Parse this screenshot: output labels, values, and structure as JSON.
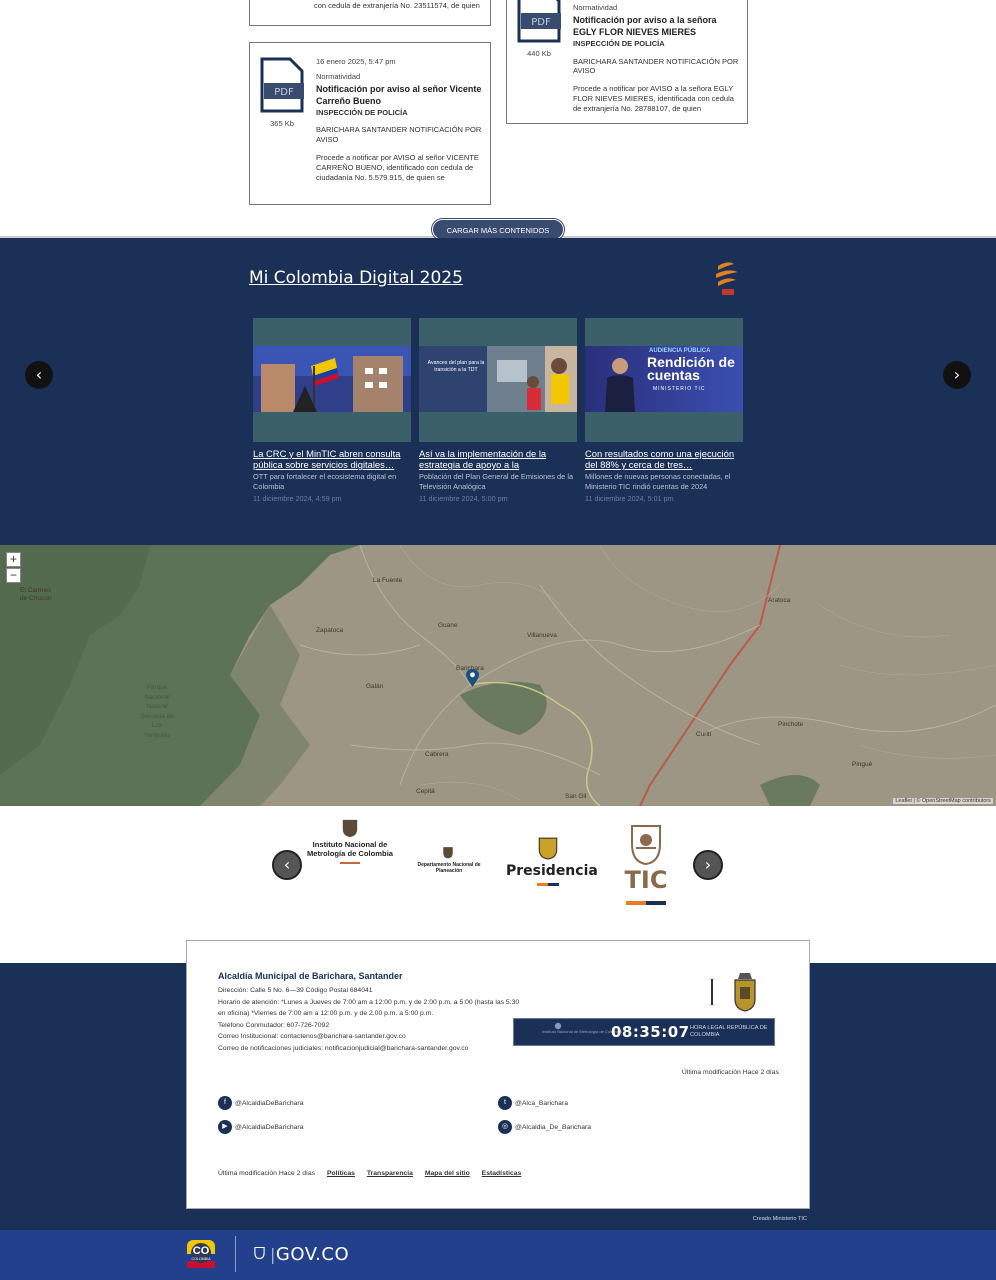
{
  "documents": [
    {
      "tail": "con cedula de extranjería No. 23511574, de quien"
    },
    {
      "cat": "Normatividad",
      "title": "Notificación por aviso a la señora EGLY FLOR NIEVES MIERES",
      "sub": "INSPECCIÓN DE POLICÍA",
      "region": "BARICHARA SANTANDER NOTIFICACIÓN POR AVISO",
      "desc": "Procede a notificar por AVISO a la señora EGLY FLOR NIEVES MIERES, identificada con cedula de extranjería No. 28788107, de quien",
      "size": "440 Kb"
    },
    {
      "date": "16 enero 2025, 5:47 pm",
      "cat": "Normatividad",
      "title": "Notificación por aviso al señor Vicente Carreño Bueno",
      "sub": "INSPECCIÓN DE POLICÍA",
      "region": "BARICHARA SANTANDER NOTIFICACIÓN POR AVISO",
      "desc": "Procede a notificar por AVISO al señor VICENTE CARREÑO BUENO, identificado con cedula de ciudadanía No. 5.579.915, de quien se",
      "size": "365 Kb"
    }
  ],
  "load_more": "CARGAR MÁS CONTENIDOS",
  "mcd": {
    "title": "Mi Colombia Digital 2025",
    "prev": "‹",
    "next": "›",
    "news": [
      {
        "title": "La CRC y el MinTIC abren consulta pública sobre servicios digitales…",
        "desc": "OTT para fortalecer el ecosistema digital en Colombia",
        "date": "11 diciembre 2024, 4:59 pm"
      },
      {
        "title": "Así va la implementación de la estrategia de apoyo a la",
        "desc": "Población del Plan General de Emisiones de la Televisión Analógica",
        "date": "11 diciembre 2024, 5:00 pm",
        "img_text": "Avances del plan para la transición a la TDT"
      },
      {
        "title": "Con resultados como una ejecución del 88% y cerca de tres…",
        "desc": "Millones de nuevas personas conectadas, el Ministerio TIC rindió cuentas de 2024",
        "date": "11 diciembre 2024, 5:01 pm",
        "img_title": "AUDIENCIA PÚBLICA",
        "img_big": "Rendición de cuentas",
        "img_sub": "MINISTERIO TIC"
      }
    ]
  },
  "map": {
    "zoom_in": "+",
    "zoom_out": "−",
    "attribution": "Leaflet | © OpenStreetMap contributors",
    "labels": [
      "El Carmen de Chucurí",
      "La Fuente",
      "Galán",
      "Guane",
      "Villanueva",
      "Barichara",
      "Cabrera",
      "Curití",
      "Aratoca",
      "Pinchote",
      "Parque Nacional Natural Serranía de Los Yariguíes",
      "San Gil",
      "Cepitá",
      "Pingué",
      "Zapatoca"
    ]
  },
  "partners": {
    "prev": "‹",
    "next": "›",
    "inm": "Instituto Nacional de Metrología de Colombia",
    "dnp": "Departamento Nacional de Planeación",
    "presidencia": "Presidencia",
    "tic": "TIC"
  },
  "footer": {
    "name": "Alcaldía Municipal de Barichara, Santander",
    "address": "Dirección: Calle 5 No. 6—39 Código Postal 684041",
    "hours": "Horario de atención: *Lunes a Jueves de 7:00 am a 12:00 p.m. y de 2:00 p.m. a 5:00 (hasta las 5:30 en oficina) *Viernes de 7:00 am a 12:00 p.m. y de 2.00 p.m. a 5:00 p.m.",
    "phone": "Teléfono Conmutador: 607-726-7092",
    "email": "Correo Institucional: contactenos@barichara-santander.gov.co",
    "judicial": "Correo de notificaciones judiciales: notificacionjudicial@barichara-santander.gov.co",
    "clock": "08:35:07",
    "clock_label": "HORA LEGAL REPÚBLICA DE COLOMBIA",
    "clock_inm": "Instituto Nacional de Metrología de Colombia",
    "last_mod": "Última modificación Hace 2 días",
    "social": [
      {
        "icon": "f",
        "label": "@AlcaldiaDeBarichara"
      },
      {
        "icon": "t",
        "label": "@Alca_Barichara"
      },
      {
        "icon": "▶",
        "label": "@AlcaldiaDeBarichara"
      },
      {
        "icon": "◎",
        "label": "@Alcaldia_De_Barichara"
      }
    ],
    "bottom_mod": "Última modificación Hace 2 días",
    "links": [
      "Políticas",
      "Transparencia",
      "Mapa del sitio",
      "Estadísticas"
    ],
    "creado": "Creado Ministerio TIC"
  },
  "govbar": {
    "co": "CO",
    "colombia": "COLOMBIA",
    "gov": "GOV.CO"
  },
  "colors": {
    "navy": "#1a3057",
    "gov_blue": "#23408c",
    "teal": "#3c6069",
    "map_bg": "#9d9685",
    "forest": "#5d7358"
  },
  "icons": [
    "pdf-icon",
    "chevron-left-icon",
    "chevron-right-icon",
    "map-marker-icon",
    "facebook-icon",
    "twitter-icon",
    "youtube-icon",
    "instagram-icon",
    "shield-icon",
    "escudo-icon"
  ]
}
